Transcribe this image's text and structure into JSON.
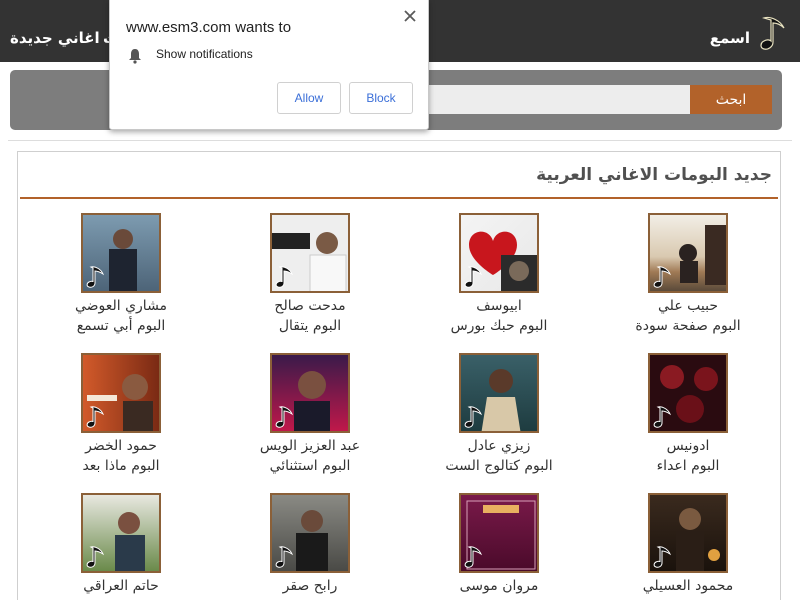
{
  "header": {
    "brand": "اسمع",
    "nav": [
      "اغاني جديدة",
      "ت"
    ]
  },
  "search": {
    "value": "",
    "placeholder": "",
    "button_label": "ابحث"
  },
  "albums_section": {
    "title": "جديد البومات الاغاني العربية",
    "albums": [
      {
        "artist": "حبيب علي",
        "album": "البوم صفحة سودة",
        "icon": "music-note-icon"
      },
      {
        "artist": "ابيوسف",
        "album": "البوم حبك بورس",
        "icon": "music-note-icon"
      },
      {
        "artist": "مدحت صالح",
        "album": "البوم يتقال",
        "icon": "music-note-icon"
      },
      {
        "artist": "مشاري العوضي",
        "album": "البوم أبي تسمع",
        "icon": "music-note-icon"
      },
      {
        "artist": "ادونيس",
        "album": "البوم اعداء",
        "icon": "music-note-icon"
      },
      {
        "artist": "زيزي عادل",
        "album": "البوم كتالوج الست",
        "icon": "music-note-icon"
      },
      {
        "artist": "عبد العزيز الويس",
        "album": "البوم استثنائي",
        "icon": "music-note-icon"
      },
      {
        "artist": "حمود الخضر",
        "album": "البوم ماذا بعد",
        "icon": "music-note-icon"
      },
      {
        "artist": "محمود العسيلي",
        "album": "",
        "icon": "music-note-icon"
      },
      {
        "artist": "مروان موسى",
        "album": "",
        "icon": "music-note-icon"
      },
      {
        "artist": "رابح صقر",
        "album": "",
        "icon": "music-note-icon"
      },
      {
        "artist": "حاتم العراقي",
        "album": "",
        "icon": "music-note-icon"
      }
    ]
  },
  "notification_popup": {
    "title": "www.esm3.com wants to",
    "message": "Show notifications",
    "allow_label": "Allow",
    "block_label": "Block",
    "icons": [
      "bell-icon",
      "close-icon"
    ]
  },
  "colors": {
    "header_bg": "#333333",
    "accent": "#b2622a",
    "search_band": "#7d7d7d",
    "link_blue": "#3b6fd8"
  }
}
